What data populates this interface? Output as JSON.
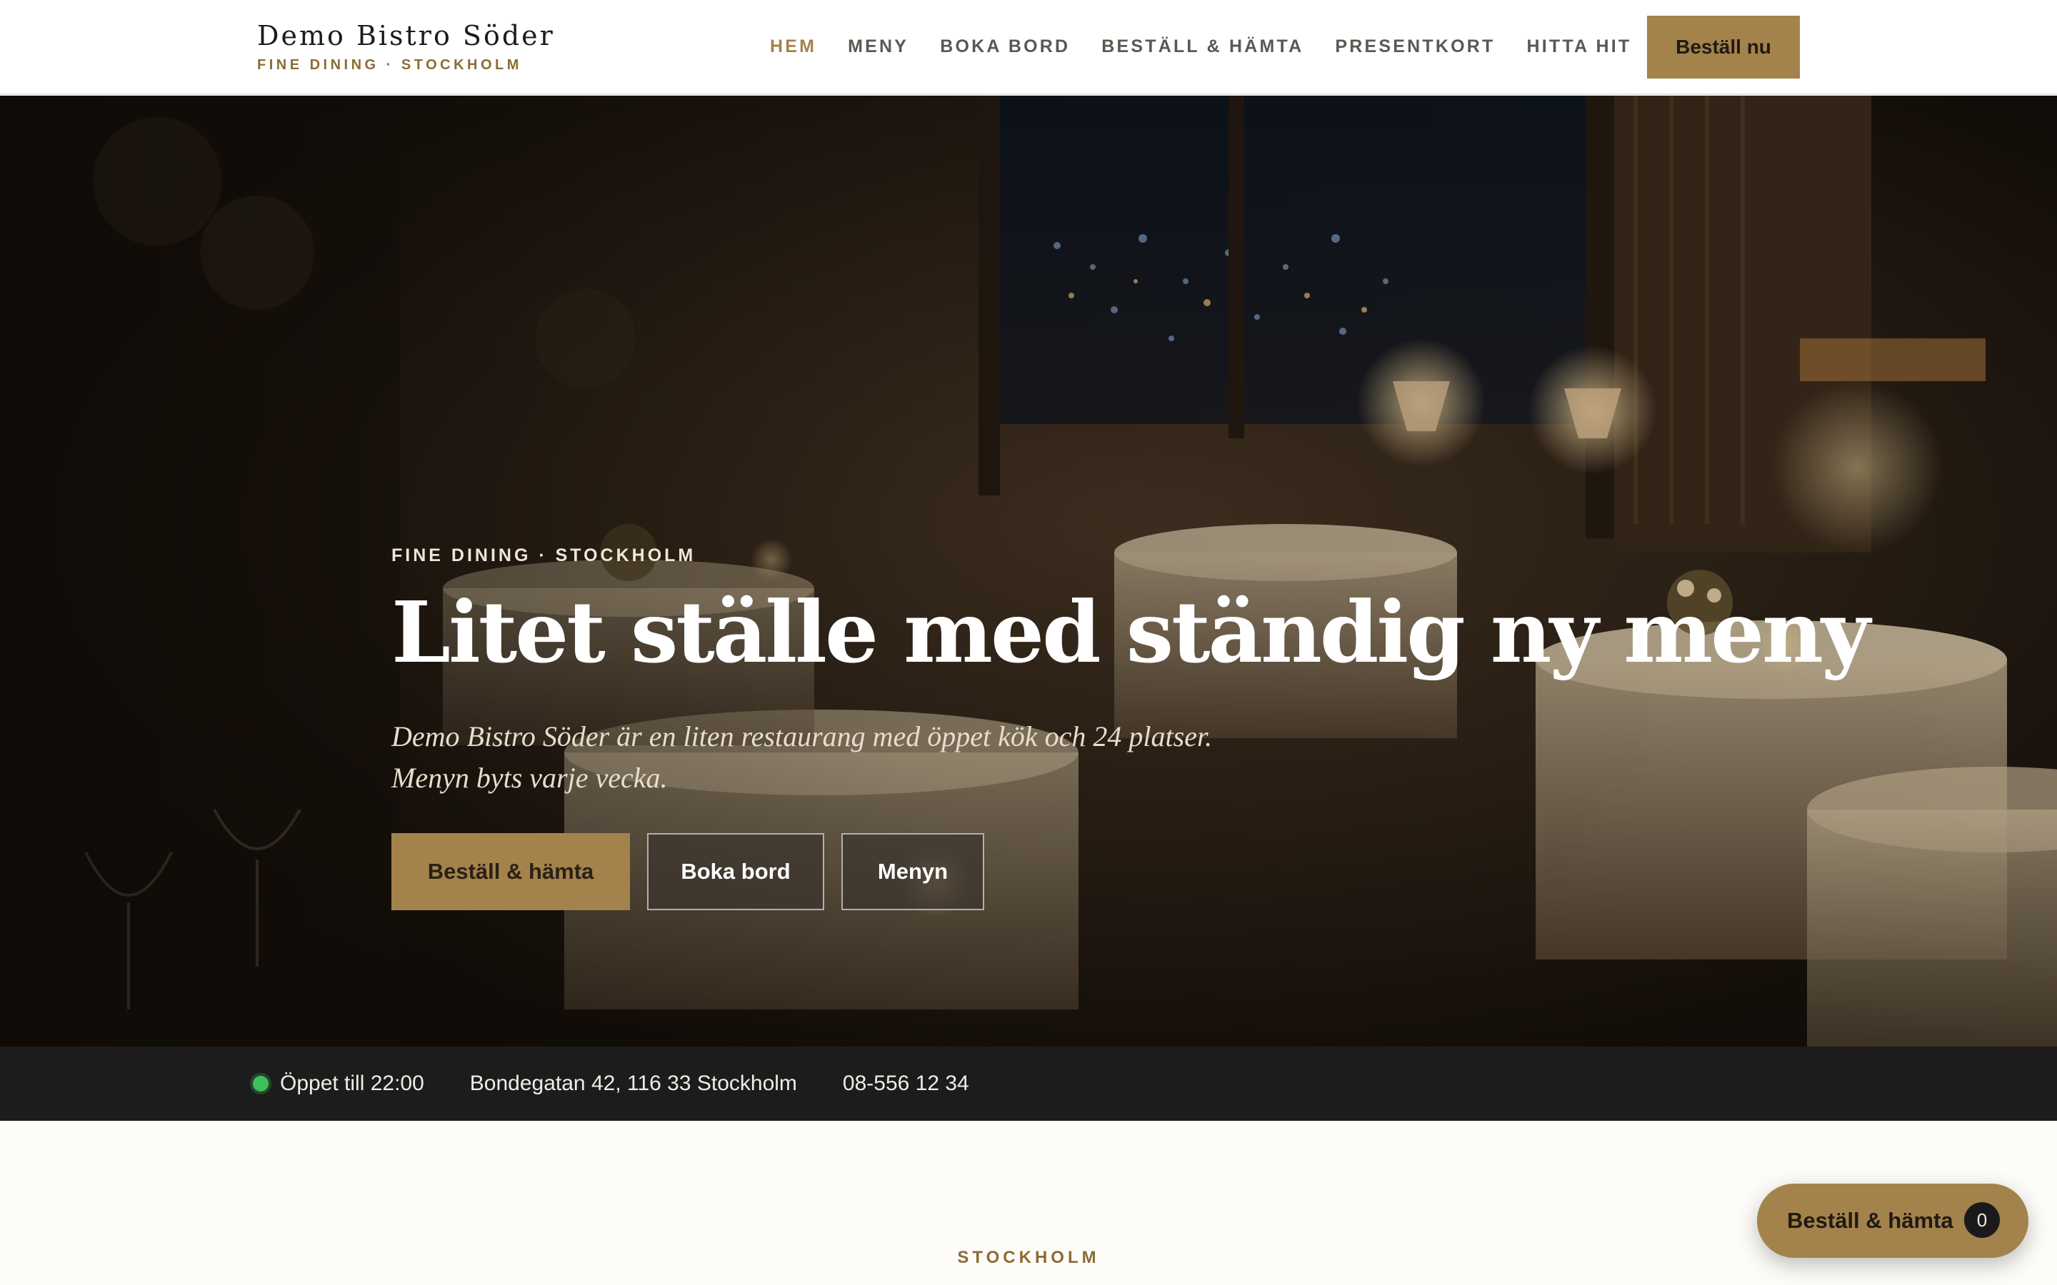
{
  "header": {
    "brand_name": "Demo Bistro Söder",
    "brand_tagline": "FINE DINING · STOCKHOLM",
    "nav": [
      {
        "label": "HEM",
        "active": true
      },
      {
        "label": "MENY",
        "active": false
      },
      {
        "label": "BOKA BORD",
        "active": false
      },
      {
        "label": "BESTÄLL & HÄMTA",
        "active": false
      },
      {
        "label": "PRESENTKORT",
        "active": false
      },
      {
        "label": "HITTA HIT",
        "active": false
      }
    ],
    "order_button": "Beställ nu"
  },
  "hero": {
    "eyebrow": "FINE DINING · STOCKHOLM",
    "title": "Litet ställe med ständig ny meny",
    "subtitle_line1": "Demo Bistro Söder är en liten restaurang med öppet kök och 24 platser.",
    "subtitle_line2": "Menyn byts varje vecka.",
    "cta_primary": "Beställ & hämta",
    "cta_secondary": "Boka bord",
    "cta_tertiary": "Menyn"
  },
  "info_bar": {
    "status": "Öppet till 22:00",
    "address": "Bondegatan 42, 116 33 Stockholm",
    "phone": "08-556 12 34"
  },
  "section": {
    "eyebrow": "STOCKHOLM"
  },
  "floating_cart": {
    "label": "Beställ & hämta",
    "count": "0"
  },
  "colors": {
    "accent": "#a4824c",
    "dark_bar": "#1c1c1c",
    "status_green": "#3fbf5c"
  }
}
